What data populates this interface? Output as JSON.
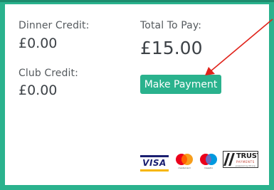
{
  "dinner_credit": {
    "label": "Dinner Credit:",
    "amount": "£0.00"
  },
  "club_credit": {
    "label": "Club Credit:",
    "amount": "£0.00"
  },
  "total": {
    "label": "Total To Pay:",
    "amount": "£15.00"
  },
  "payment_button": {
    "label": "Make Payment"
  },
  "logos": {
    "visa": "VISA",
    "mastercard": "mastercard",
    "maestro": "maestro",
    "trust": "TRUST",
    "trust_sub": "PAYMENTS",
    "trust_foot": "powered by Mcorp"
  },
  "colors": {
    "accent": "#2ab28d",
    "arrow": "#e0231b",
    "text": "#3d4247"
  },
  "icons": [
    "visa-logo",
    "mastercard-logo",
    "maestro-logo",
    "trust-payments-logo",
    "annotation-arrow"
  ]
}
